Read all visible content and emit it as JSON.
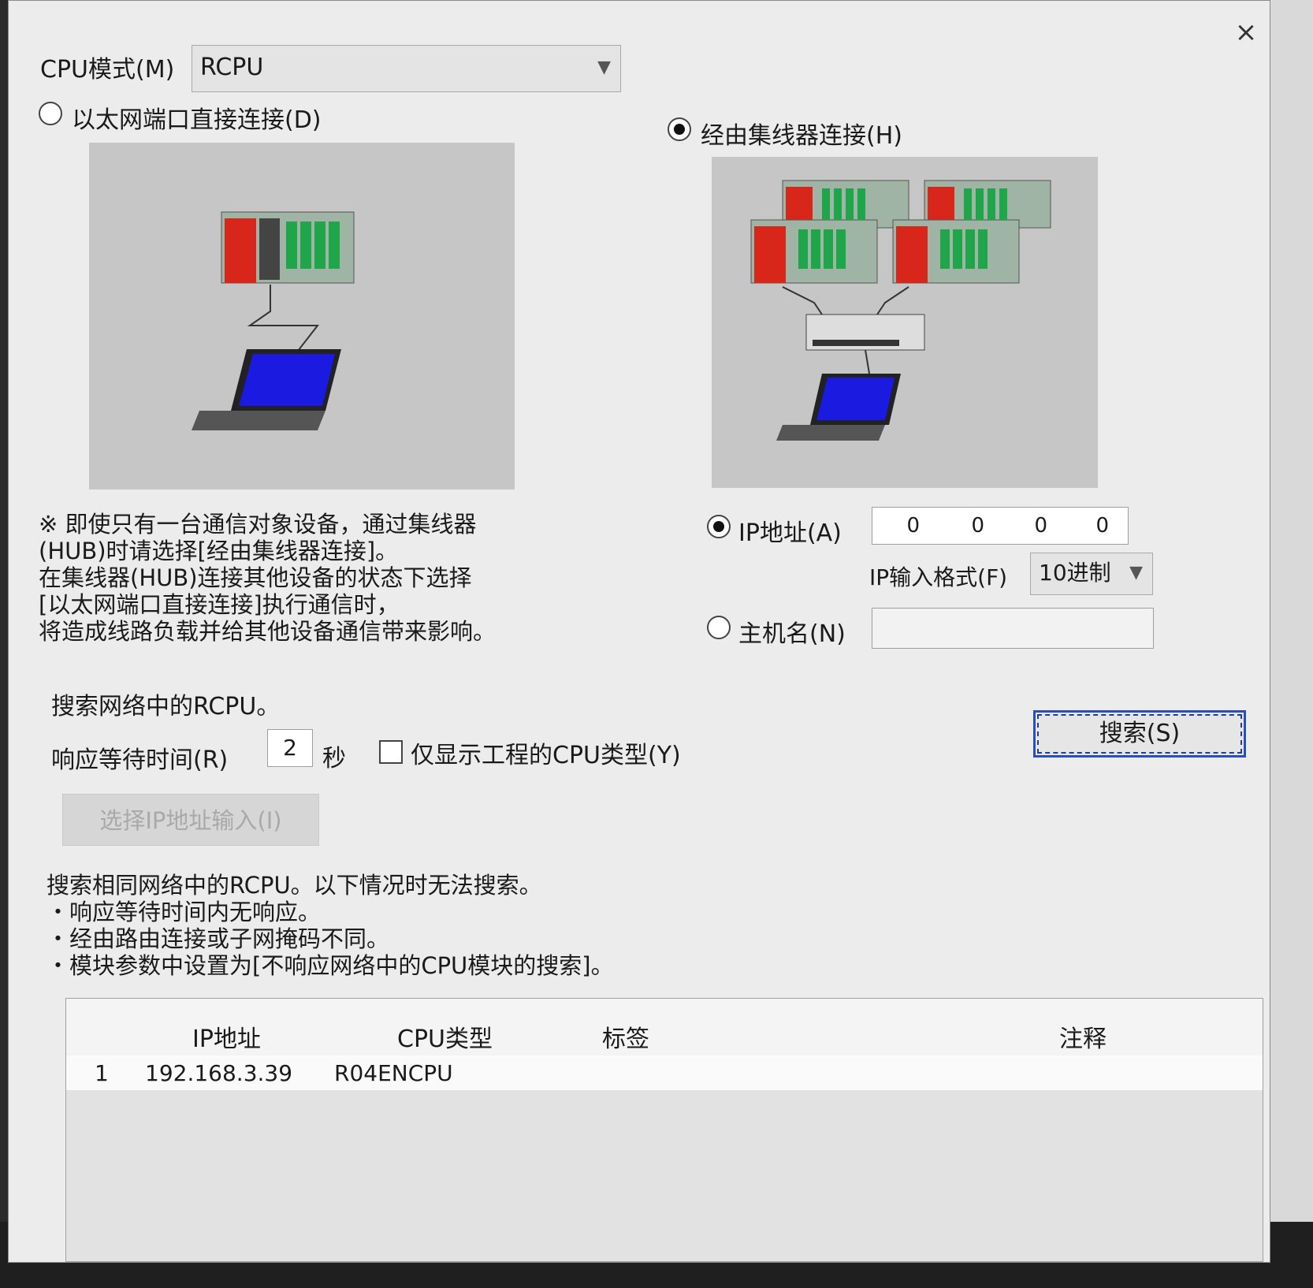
{
  "dialog": {
    "title": "",
    "close_glyph": "×"
  },
  "cpu_mode": {
    "label": "CPU模式(M)",
    "value": "RCPU"
  },
  "direct": {
    "label": "以太网端口直接连接(D)",
    "selected": false
  },
  "hub": {
    "label": "经由集线器连接(H)",
    "selected": true
  },
  "note_lines": [
    "※ 即使只有一台通信对象设备，通过集线器",
    "(HUB)时请选择[经由集线器连接]。",
    "在集线器(HUB)连接其他设备的状态下选择",
    "[以太网端口直接连接]执行通信时，",
    "将造成线路负载并给其他设备通信带来影响。"
  ],
  "ip": {
    "label": "IP地址(A)",
    "octets": [
      "0",
      "0",
      "0",
      "0"
    ],
    "selected": true
  },
  "ip_format": {
    "label": "IP输入格式(F)",
    "value": "10进制"
  },
  "hostname": {
    "label": "主机名(N)",
    "value": "",
    "selected": false
  },
  "search_section": {
    "heading": "搜索网络中的RCPU。",
    "wait_label": "响应等待时间(R)",
    "wait_value": "2",
    "wait_unit": "秒",
    "only_project_label": "仅显示工程的CPU类型(Y)",
    "search_button": "搜索(S)",
    "select_ip_button": "选择IP地址输入(I)"
  },
  "search_notes": [
    "搜索相同网络中的RCPU。以下情况时无法搜索。",
    "・响应等待时间内无响应。",
    "・经由路由连接或子网掩码不同。",
    "・模块参数中设置为[不响应网络中的CPU模块的搜索]。"
  ],
  "table": {
    "columns": [
      "IP地址",
      "CPU类型",
      "标签",
      "注释"
    ],
    "rows": [
      {
        "index": "1",
        "ip": "192.168.3.39",
        "cpu": "R04ENCPU",
        "label": "",
        "comment": ""
      }
    ]
  },
  "colors": {
    "focus": "#2a4fb8",
    "plc_red": "#d8271a",
    "plc_green": "#1fa64a",
    "screen_blue": "#1a1ae0"
  }
}
